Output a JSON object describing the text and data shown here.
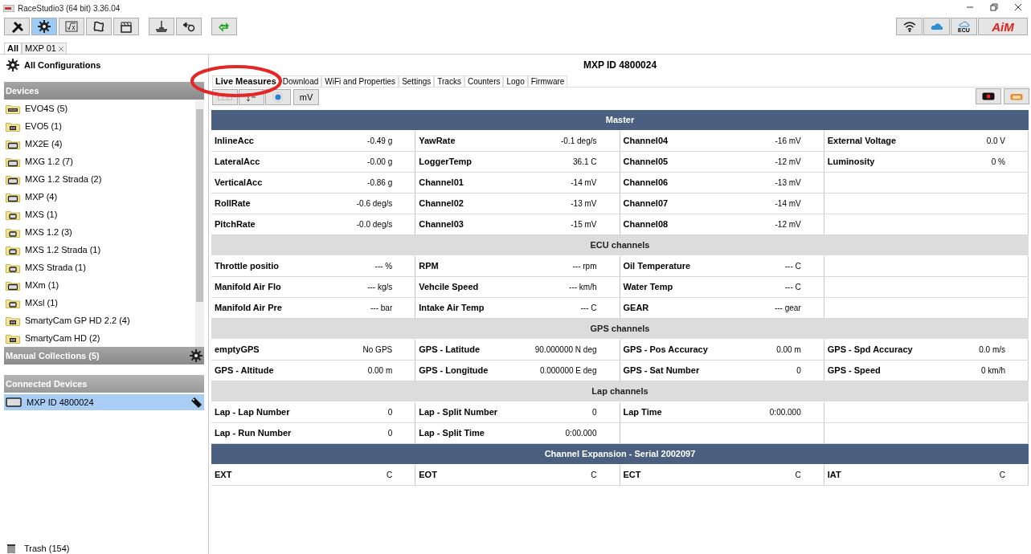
{
  "window": {
    "title": "RaceStudio3 (64 bit) 3.36.04"
  },
  "toolbar": [
    {
      "kind": "wrench",
      "selected": false
    },
    {
      "kind": "gear",
      "selected": true
    },
    {
      "kind": "math",
      "selected": false
    },
    {
      "kind": "track",
      "selected": false
    },
    {
      "kind": "clapper",
      "selected": false
    },
    {
      "kind": "bars",
      "selected": false
    },
    {
      "kind": "arrowgear",
      "selected": false
    },
    {
      "kind": "transfer",
      "selected": false
    }
  ],
  "right_buttons": [
    {
      "kind": "wifi"
    },
    {
      "kind": "cloud"
    },
    {
      "kind": "ecu",
      "label": "ECU"
    },
    {
      "kind": "logo",
      "label": "AiM"
    }
  ],
  "doc_tabs": [
    {
      "label": "All",
      "selected": true
    },
    {
      "label": "MXP 01",
      "selected": false,
      "closable": true
    }
  ],
  "sidebar": {
    "title": "All Configurations",
    "devices_header": "Devices",
    "items": [
      {
        "label": "EVO4S  (5)",
        "kind": "evo"
      },
      {
        "label": "EVO5  (1)",
        "kind": "cam"
      },
      {
        "label": "MX2E  (4)",
        "kind": "dash"
      },
      {
        "label": "MXG 1.2  (7)",
        "kind": "dash"
      },
      {
        "label": "MXG 1.2 Strada  (2)",
        "kind": "dash"
      },
      {
        "label": "MXP  (4)",
        "kind": "dash"
      },
      {
        "label": "MXS  (1)",
        "kind": "small"
      },
      {
        "label": "MXS 1.2  (3)",
        "kind": "small"
      },
      {
        "label": "MXS 1.2 Strada  (1)",
        "kind": "small"
      },
      {
        "label": "MXS Strada  (1)",
        "kind": "small"
      },
      {
        "label": "MXm  (1)",
        "kind": "dash"
      },
      {
        "label": "MXsl  (1)",
        "kind": "small"
      },
      {
        "label": "SmartyCam GP HD 2.2  (4)",
        "kind": "cam"
      },
      {
        "label": "SmartyCam HD  (2)",
        "kind": "cam"
      }
    ],
    "manual_collections": "Manual Collections  (5)",
    "connected_header": "Connected Devices",
    "connected": [
      {
        "label": "MXP ID 4800024",
        "selected": true
      }
    ],
    "trash": "Trash (154)"
  },
  "device_title": "MXP ID 4800024",
  "tabs": [
    {
      "label": "Live Measures",
      "selected": true
    },
    {
      "label": "Download",
      "selected": false
    },
    {
      "label": "WiFi and Properties",
      "selected": false
    },
    {
      "label": "Settings",
      "selected": false
    },
    {
      "label": "Tracks",
      "selected": false
    },
    {
      "label": "Counters",
      "selected": false
    },
    {
      "label": "Logo",
      "selected": false
    },
    {
      "label": "Firmware",
      "selected": false
    }
  ],
  "tools": [
    {
      "kind": "grid"
    },
    {
      "kind": "axis"
    },
    {
      "kind": "target"
    },
    {
      "kind": "text",
      "label": "mV"
    }
  ],
  "sections": [
    {
      "title": "Master",
      "kind": "primary",
      "rows": [
        [
          {
            "label": "InlineAcc",
            "value": "-0.49 g"
          },
          {
            "label": "YawRate",
            "value": "-0.1 deg/s"
          },
          {
            "label": "Channel04",
            "value": "-16 mV"
          },
          {
            "label": "External Voltage",
            "value": "0.0 V"
          }
        ],
        [
          {
            "label": "LateralAcc",
            "value": "-0.00 g"
          },
          {
            "label": "LoggerTemp",
            "value": "36.1 C"
          },
          {
            "label": "Channel05",
            "value": "-12 mV"
          },
          {
            "label": "Luminosity",
            "value": "0 %"
          }
        ],
        [
          {
            "label": "VerticalAcc",
            "value": "-0.86 g"
          },
          {
            "label": "Channel01",
            "value": "-14 mV"
          },
          {
            "label": "Channel06",
            "value": "-13 mV"
          },
          null
        ],
        [
          {
            "label": "RollRate",
            "value": "-0.6 deg/s"
          },
          {
            "label": "Channel02",
            "value": "-13 mV"
          },
          {
            "label": "Channel07",
            "value": "-14 mV"
          },
          null
        ],
        [
          {
            "label": "PitchRate",
            "value": "-0.0 deg/s"
          },
          {
            "label": "Channel03",
            "value": "-15 mV"
          },
          {
            "label": "Channel08",
            "value": "-12 mV"
          },
          null
        ]
      ]
    },
    {
      "title": "ECU channels",
      "kind": "secondary",
      "rows": [
        [
          {
            "label": "Throttle positio",
            "value": "--- %"
          },
          {
            "label": "RPM",
            "value": "--- rpm"
          },
          {
            "label": "Oil Temperature",
            "value": "--- C"
          },
          null
        ],
        [
          {
            "label": "Manifold Air Flo",
            "value": "--- kg/s"
          },
          {
            "label": "Vehcile Speed",
            "value": "--- km/h"
          },
          {
            "label": "Water Temp",
            "value": "--- C"
          },
          null
        ],
        [
          {
            "label": "Manifold Air Pre",
            "value": "--- bar"
          },
          {
            "label": "Intake Air Temp",
            "value": "--- C"
          },
          {
            "label": "GEAR",
            "value": "--- gear"
          },
          null
        ]
      ]
    },
    {
      "title": "GPS channels",
      "kind": "secondary",
      "rows": [
        [
          {
            "label": "emptyGPS",
            "value": "No GPS"
          },
          {
            "label": "GPS - Latitude",
            "value": "90.000000 N deg"
          },
          {
            "label": "GPS - Pos Accuracy",
            "value": "0.00 m"
          },
          {
            "label": "GPS - Spd Accuracy",
            "value": "0.0 m/s"
          }
        ],
        [
          {
            "label": "GPS - Altitude",
            "value": "0.00 m"
          },
          {
            "label": "GPS - Longitude",
            "value": "0.000000 E deg"
          },
          {
            "label": "GPS - Sat Number",
            "value": "0"
          },
          {
            "label": "GPS - Speed",
            "value": "0 km/h"
          }
        ]
      ]
    },
    {
      "title": "Lap channels",
      "kind": "secondary",
      "rows": [
        [
          {
            "label": "Lap - Lap Number",
            "value": "0"
          },
          {
            "label": "Lap - Split Number",
            "value": "0"
          },
          {
            "label": "Lap Time",
            "value": "0:00.000"
          },
          null
        ],
        [
          {
            "label": "Lap - Run Number",
            "value": "0"
          },
          {
            "label": "Lap - Split Time",
            "value": "0:00.000"
          },
          null,
          null
        ]
      ]
    },
    {
      "title": "Channel Expansion - Serial 2002097",
      "kind": "primary",
      "rows": [
        [
          {
            "label": "EXT",
            "value": "C"
          },
          {
            "label": "EOT",
            "value": "C"
          },
          {
            "label": "ECT",
            "value": "C"
          },
          {
            "label": "IAT",
            "value": "C"
          }
        ]
      ]
    }
  ]
}
